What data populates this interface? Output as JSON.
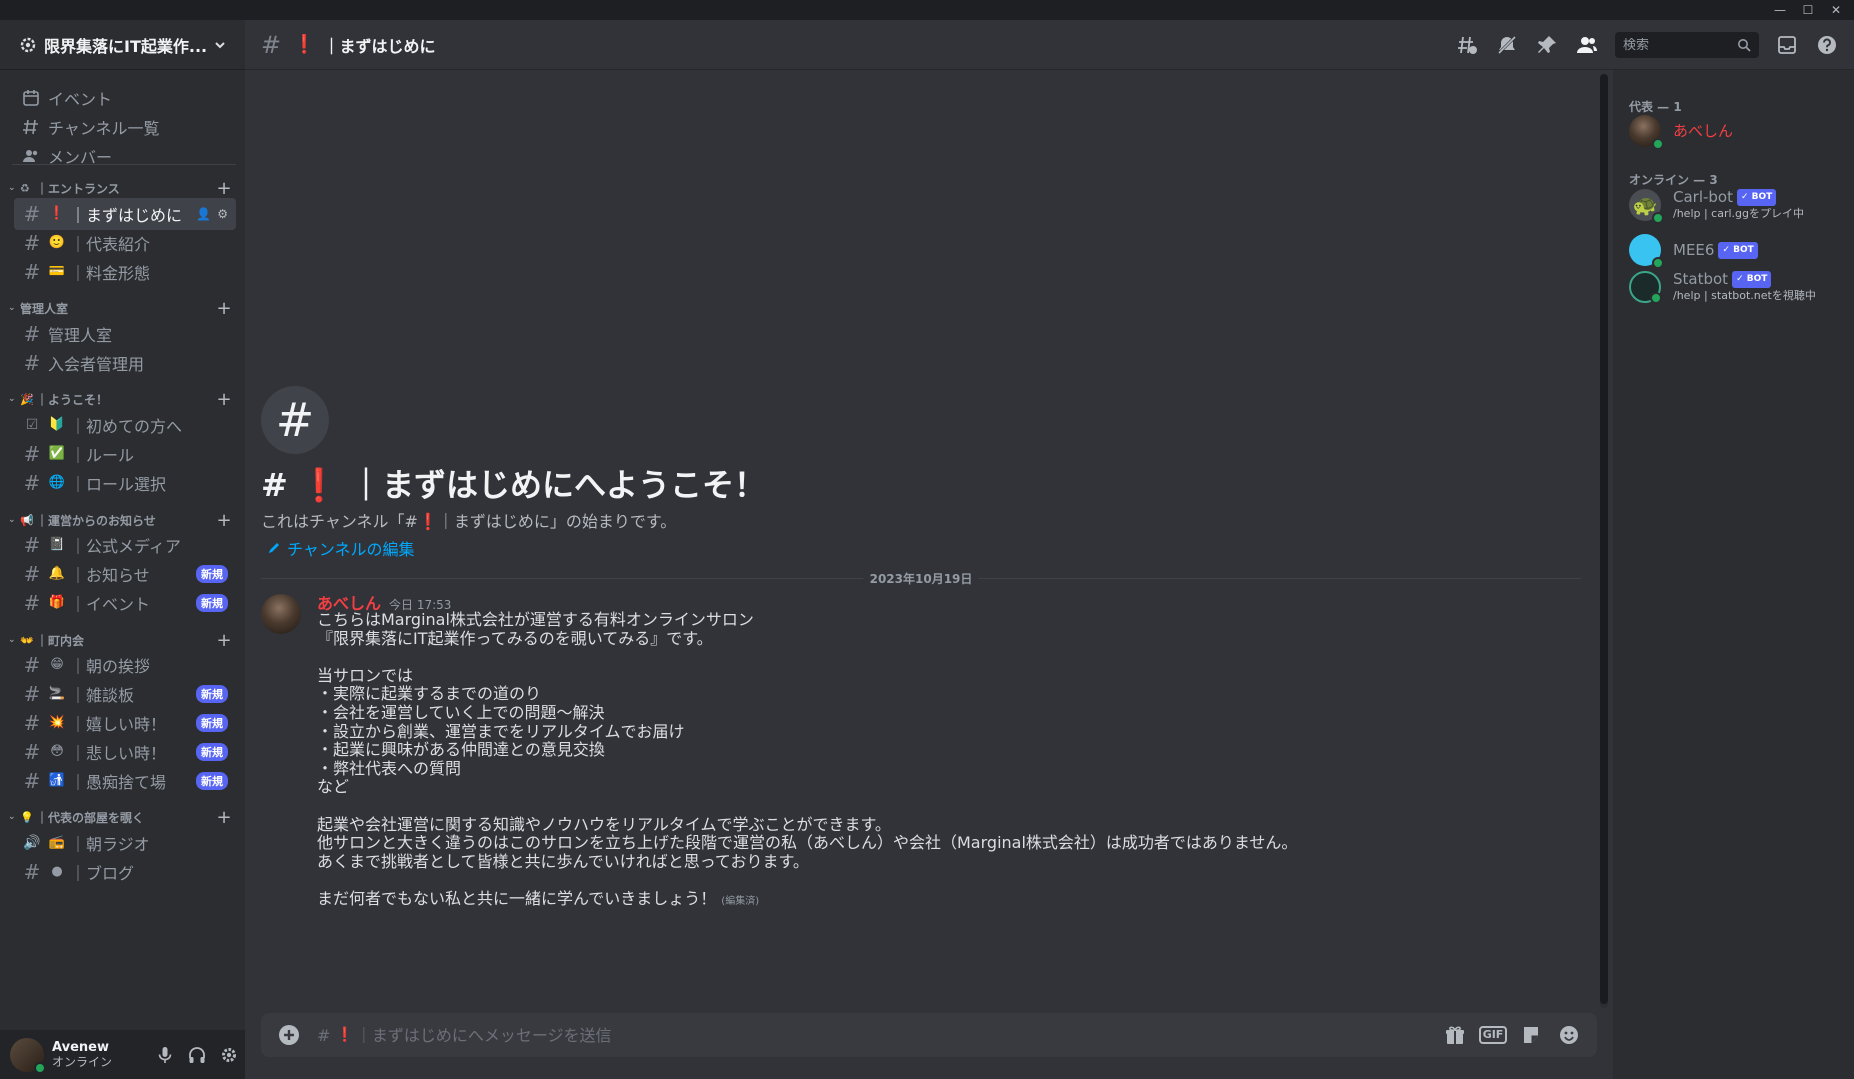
{
  "titlebar": {
    "minimize": "—",
    "maximize": "☐",
    "close": "✕"
  },
  "guild": {
    "name": "限界集落にIT起業作..."
  },
  "sidebar": {
    "nav": [
      {
        "label": "イベント",
        "icon": "calendar-icon"
      },
      {
        "label": "チャンネル一覧",
        "icon": "channels-browse-icon"
      },
      {
        "label": "メンバー",
        "icon": "members-icon"
      }
    ],
    "categories": [
      {
        "name": "｜エントランス",
        "emoji": "♻",
        "channels": [
          {
            "emoji": "❗",
            "name": "｜まずはじめに",
            "active": true
          },
          {
            "emoji": "🙂",
            "name": "｜代表紹介"
          },
          {
            "emoji": "💳",
            "name": "｜料金形態"
          }
        ]
      },
      {
        "name": "管理人室",
        "emoji": "",
        "channels": [
          {
            "emoji": "",
            "name": "管理人室"
          },
          {
            "emoji": "",
            "name": "入会者管理用"
          }
        ]
      },
      {
        "name": "｜ようこそ！",
        "emoji": "🎉",
        "channels": [
          {
            "emoji": "🔰",
            "name": "｜初めての方へ",
            "icon": "checkbox-icon"
          },
          {
            "emoji": "✅",
            "name": "｜ルール"
          },
          {
            "emoji": "🌐",
            "name": "｜ロール選択"
          }
        ]
      },
      {
        "name": "｜運営からのお知らせ",
        "emoji": "📢",
        "channels": [
          {
            "emoji": "📓",
            "name": "｜公式メディア"
          },
          {
            "emoji": "🔔",
            "name": "｜お知らせ",
            "badge": "新規"
          },
          {
            "emoji": "🎁",
            "name": "｜イベント",
            "badge": "新規"
          }
        ]
      },
      {
        "name": "｜町内会",
        "emoji": "👐",
        "channels": [
          {
            "emoji": "😁",
            "name": "｜朝の挨拶"
          },
          {
            "emoji": "🚬",
            "name": "｜雑談板",
            "badge": "新規"
          },
          {
            "emoji": "💥",
            "name": "｜嬉しい時！",
            "badge": "新規"
          },
          {
            "emoji": "😳",
            "name": "｜悲しい時！",
            "badge": "新規"
          },
          {
            "emoji": "🚮",
            "name": "｜愚痴捨て場",
            "badge": "新規"
          }
        ]
      },
      {
        "name": "｜代表の部屋を覗く",
        "emoji": "💡",
        "channels": [
          {
            "emoji": "📻",
            "name": "｜朝ラジオ",
            "icon": "voice-icon"
          },
          {
            "emoji": "●",
            "name": "｜ブログ"
          }
        ]
      }
    ]
  },
  "user": {
    "name": "Avenew",
    "status": "オンライン"
  },
  "header": {
    "emoji": "❗",
    "title": "｜まずはじめに",
    "search_placeholder": "検索"
  },
  "welcome": {
    "icon": "#",
    "title_prefix": "#",
    "title_emoji": "❗",
    "title_rest": "｜まずはじめにへようこそ！",
    "sub_a": "これはチャンネル「#",
    "sub_emoji": "❗",
    "sub_b": "｜まずはじめに」の始まりです。",
    "edit_label": "チャンネルの編集"
  },
  "date_divider": "2023年10月19日",
  "message": {
    "author": "あべしん",
    "time": "今日 17:53",
    "body": "こちらはMarginal株式会社が運営する有料オンラインサロン\n『限界集落にIT起業作ってみるのを覗いてみる』です。\n\n当サロンでは\n・実際に起業するまでの道のり\n・会社を運営していく上での問題〜解決\n・設立から創業、運営までをリアルタイムでお届け\n・起業に興味がある仲間達との意見交換\n・弊社代表への質問\nなど\n\n起業や会社運営に関する知識やノウハウをリアルタイムで学ぶことができます。\n他サロンと大きく違うのはこのサロンを立ち上げた段階で運営の私（あべしん）や会社（Marginal株式会社）は成功者ではありません。\nあくまで挑戦者として皆様と共に歩んでいければと思っております。\n\nまだ何者でもない私と共に一緒に学んでいきましょう！",
    "edited": "(編集済)"
  },
  "composer": {
    "hash": "#",
    "emoji": "❗",
    "placeholder": "｜まずはじめにへメッセージを送信",
    "gif_label": "GIF"
  },
  "members": {
    "groups": [
      {
        "title": "代表 — 1",
        "members": [
          {
            "name": "あべしん",
            "color": "#f23f43"
          }
        ]
      },
      {
        "title": "オンライン — 3",
        "members": [
          {
            "name": "Carl-bot",
            "bot": "✓ BOT",
            "activity": "/help | carl.ggをプレイ中"
          },
          {
            "name": "MEE6",
            "bot": "✓ BOT",
            "activity": ""
          },
          {
            "name": "Statbot",
            "bot": "✓ BOT",
            "activity": "/help | statbot.netを視聴中"
          }
        ]
      }
    ]
  },
  "colors": {
    "accent": "#5865f2",
    "online": "#23a55a",
    "link": "#00a8fc",
    "owner_name": "#f23f43"
  }
}
